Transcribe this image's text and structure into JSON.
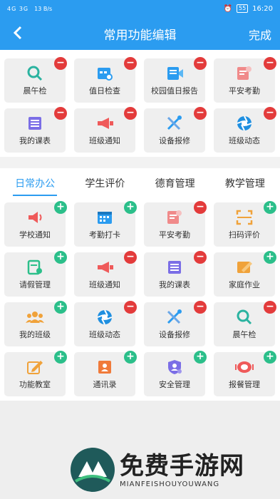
{
  "status": {
    "signal": "4G 3G",
    "speed": "13 B/s",
    "battery": "55",
    "time": "16:20"
  },
  "nav": {
    "title": "常用功能编辑",
    "done": "完成"
  },
  "common": [
    {
      "label": "晨午检",
      "icon": "magnifier-icon",
      "badge": "−"
    },
    {
      "label": "值日检查",
      "icon": "calendar-search-icon",
      "badge": "−"
    },
    {
      "label": "校园值日报告",
      "icon": "report-icon",
      "badge": "−"
    },
    {
      "label": "平安考勤",
      "icon": "attendance-icon",
      "badge": "−"
    },
    {
      "label": "我的课表",
      "icon": "schedule-icon",
      "badge": "−"
    },
    {
      "label": "班级通知",
      "icon": "megaphone-icon",
      "badge": "−"
    },
    {
      "label": "设备报修",
      "icon": "tools-icon",
      "badge": "−"
    },
    {
      "label": "班级动态",
      "icon": "aperture-icon",
      "badge": "−"
    }
  ],
  "tabs": [
    {
      "label": "日常办公"
    },
    {
      "label": "学生评价"
    },
    {
      "label": "德育管理"
    },
    {
      "label": "教学管理"
    }
  ],
  "all": [
    {
      "label": "学校通知",
      "icon": "speaker-icon",
      "badge": "+"
    },
    {
      "label": "考勤打卡",
      "icon": "calendar-icon",
      "badge": "+"
    },
    {
      "label": "平安考勤",
      "icon": "attendance-icon",
      "badge": "−"
    },
    {
      "label": "扫码评价",
      "icon": "scan-icon",
      "badge": "+"
    },
    {
      "label": "请假管理",
      "icon": "leave-icon",
      "badge": "+"
    },
    {
      "label": "班级通知",
      "icon": "megaphone-icon",
      "badge": "−"
    },
    {
      "label": "我的课表",
      "icon": "schedule-icon",
      "badge": "−"
    },
    {
      "label": "家庭作业",
      "icon": "homework-icon",
      "badge": "+"
    },
    {
      "label": "我的班级",
      "icon": "group-icon",
      "badge": "+"
    },
    {
      "label": "班级动态",
      "icon": "aperture-icon",
      "badge": "−"
    },
    {
      "label": "设备报修",
      "icon": "tools-icon",
      "badge": "−"
    },
    {
      "label": "晨午检",
      "icon": "magnifier-icon",
      "badge": "−"
    },
    {
      "label": "功能教室",
      "icon": "pencil-icon",
      "badge": "+"
    },
    {
      "label": "通讯录",
      "icon": "contacts-icon",
      "badge": "+"
    },
    {
      "label": "安全管理",
      "icon": "shield-user-icon",
      "badge": "+"
    },
    {
      "label": "报餐管理",
      "icon": "meal-icon",
      "badge": "+"
    }
  ],
  "watermark": {
    "big": "免费手游网",
    "small": "MIANFEISHOUYOUWANG"
  },
  "colors": {
    "primary": "#2b9cf0",
    "remove": "#e33b3b",
    "add": "#2bbf8a"
  }
}
